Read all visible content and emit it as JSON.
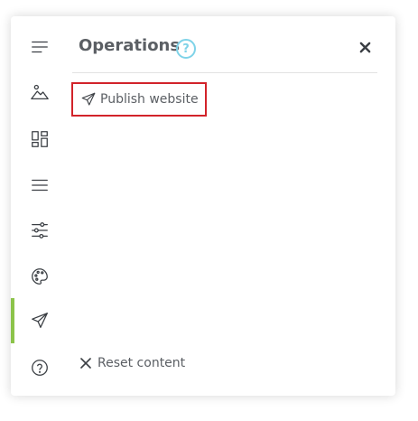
{
  "panel": {
    "title": "Operations",
    "help_badge": "?",
    "close_icon": "close-icon"
  },
  "rail": {
    "items": [
      {
        "icon": "menu-lines-icon",
        "active": false
      },
      {
        "icon": "image-icon",
        "active": false
      },
      {
        "icon": "layout-dashboard-icon",
        "active": false
      },
      {
        "icon": "hamburger-icon",
        "active": false
      },
      {
        "icon": "sliders-icon",
        "active": false
      },
      {
        "icon": "palette-icon",
        "active": false
      },
      {
        "icon": "send-icon",
        "active": true
      },
      {
        "icon": "help-circle-icon",
        "active": false
      }
    ],
    "active_color": "#8cc34a"
  },
  "operations": {
    "publish_label": "Publish website",
    "reset_label": "Reset content"
  },
  "colors": {
    "highlight_border": "#d2232a",
    "help_accent": "#7fd3e8",
    "text": "#5b5f64"
  }
}
